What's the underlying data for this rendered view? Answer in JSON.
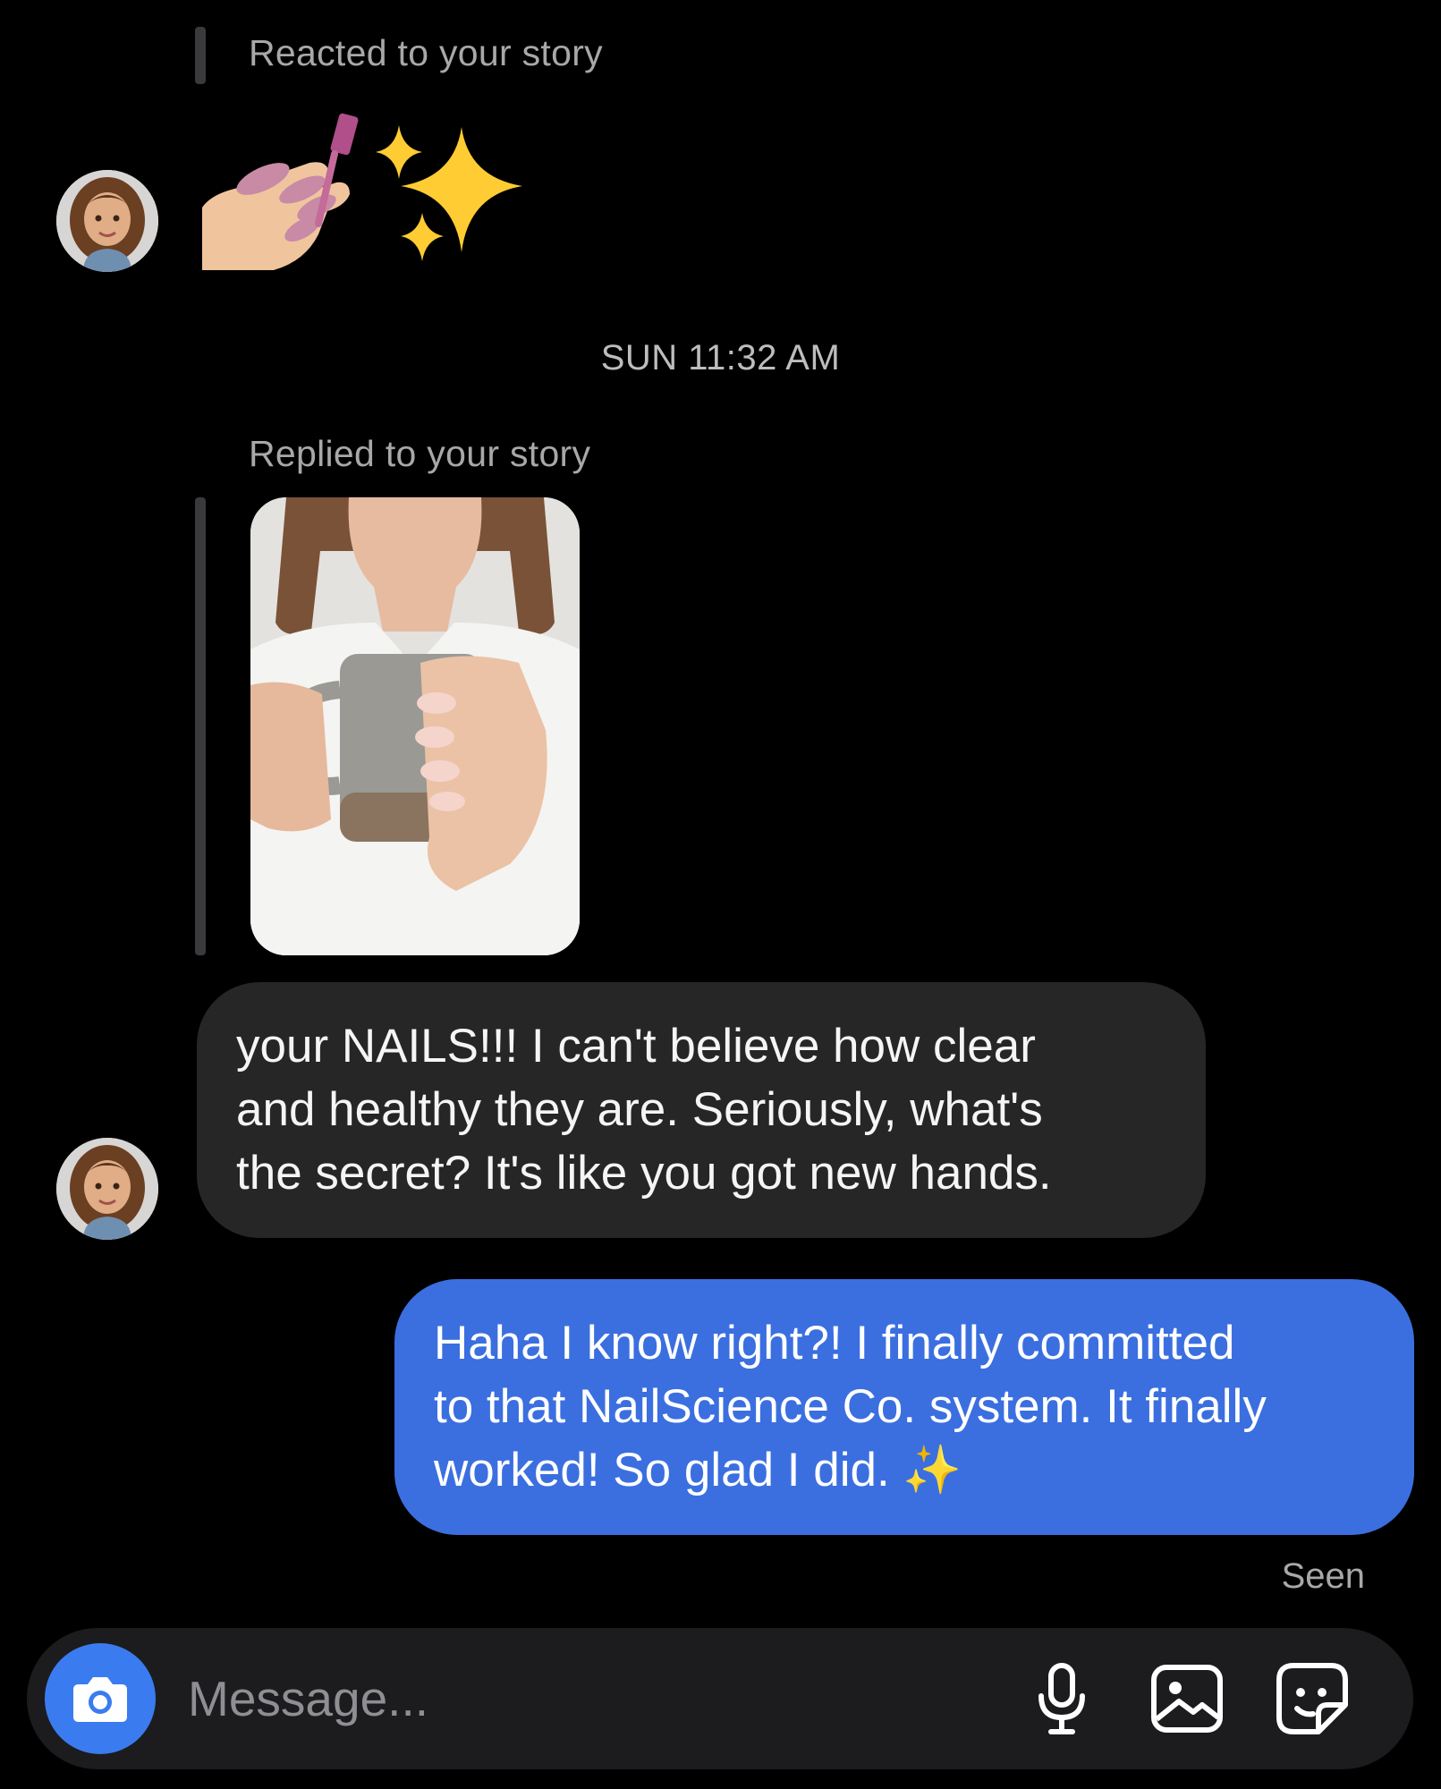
{
  "thread": {
    "reaction": {
      "label": "Reacted to your story",
      "emoji": "💅✨",
      "avatar_icon": "memoji-avatar-icon"
    },
    "timestamp": "SUN 11:32 AM",
    "reply": {
      "label": "Replied to your story",
      "story_image": "woman-holding-mug-photo",
      "avatar_icon": "memoji-avatar-icon"
    },
    "incoming_message": {
      "lines": [
        "your NAILS!!! I can't believe how clear",
        "and healthy they are. Seriously, what's",
        "the secret? It's like you got new hands."
      ]
    },
    "outgoing_message": {
      "lines": [
        "Haha I know right?! I finally committed",
        "to that NailScience Co. system. It finally",
        "worked! So glad I did. ✨"
      ],
      "bubble_color": "#3b6fe0"
    },
    "seen_label": "Seen"
  },
  "composer": {
    "placeholder": "Message...",
    "camera_icon": "camera-icon",
    "mic_icon": "microphone-icon",
    "gallery_icon": "gallery-icon",
    "sticker_icon": "sticker-icon",
    "accent": "#3a7cf0"
  }
}
